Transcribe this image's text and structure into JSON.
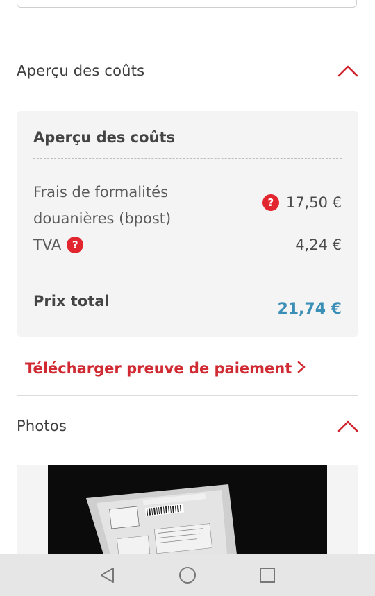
{
  "costs_section": {
    "header_title": "Aperçu des coûts",
    "card_title": "Aperçu des coûts",
    "customs_fee_label": "Frais de formalités douanières (bpost)",
    "customs_fee_amount": "17,50 €",
    "vat_label": "TVA",
    "vat_amount": "4,24 €",
    "total_label": "Prix total",
    "total_amount": "21,74 €",
    "help_symbol": "?"
  },
  "download_link": {
    "label": "Télécharger preuve de paiement",
    "icon": "chevron-right-icon"
  },
  "photos_section": {
    "header_title": "Photos"
  },
  "colors": {
    "accent_red": "#e2262f",
    "link_red": "#d02a33",
    "total_blue": "#3b8fb7",
    "card_bg": "#f4f4f4"
  },
  "navbar": {
    "icons": [
      "back-triangle-icon",
      "home-circle-icon",
      "recents-square-icon"
    ]
  }
}
